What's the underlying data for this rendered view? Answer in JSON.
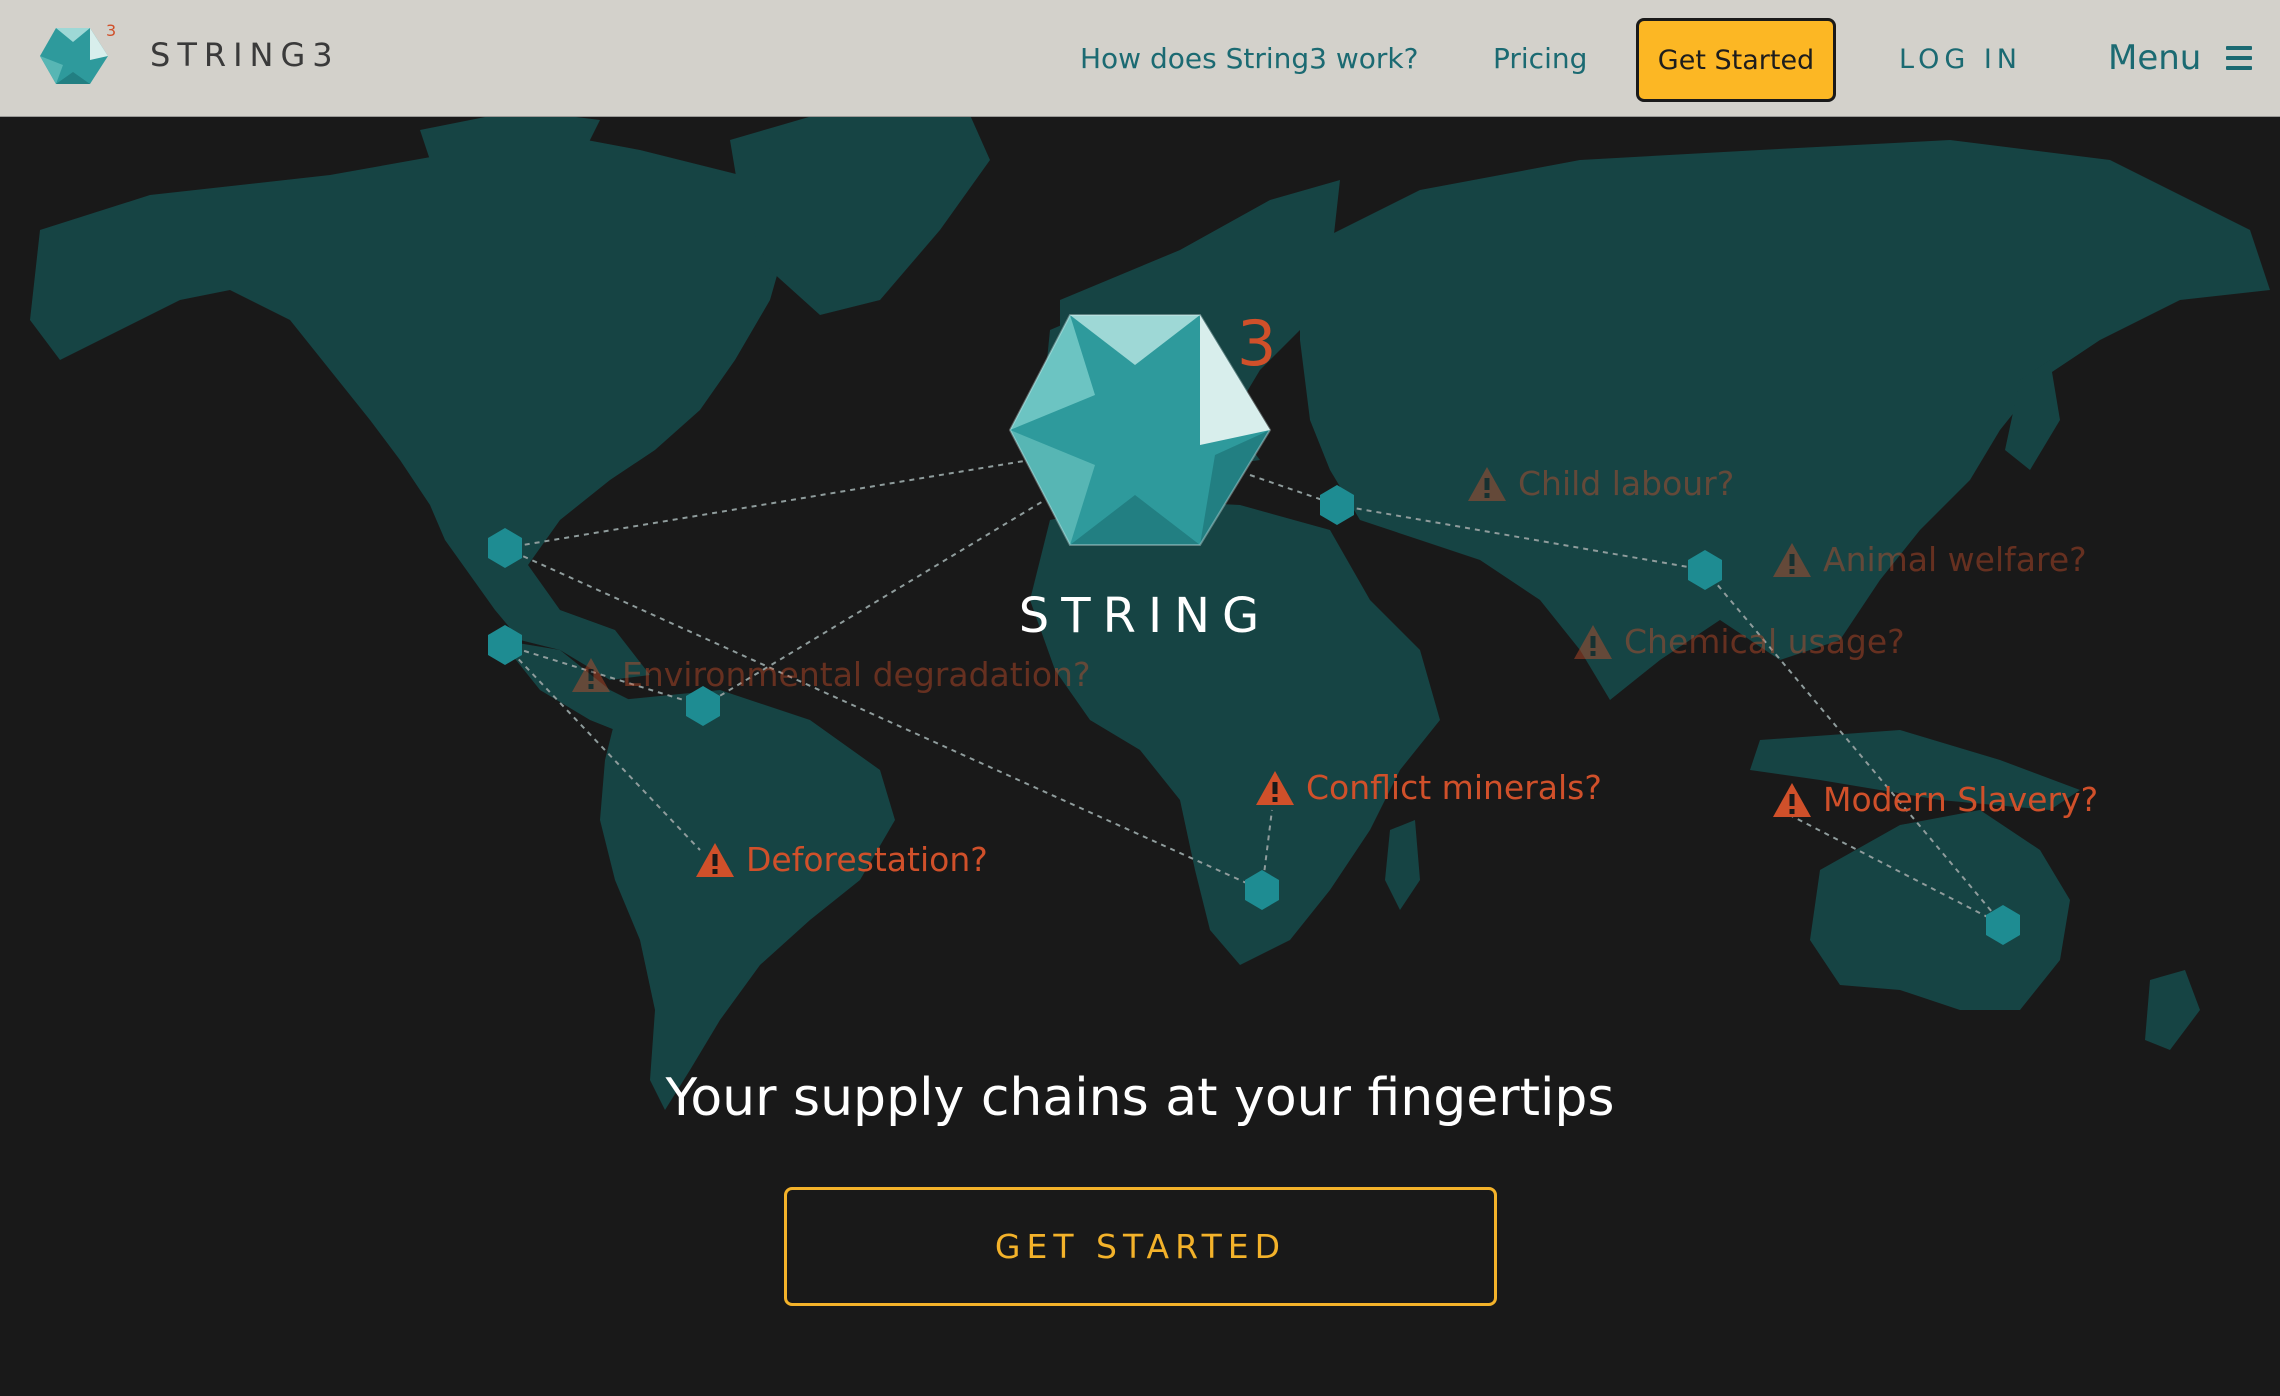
{
  "header": {
    "brand": "STRING3",
    "nav_links": [
      "How does String3 work?",
      "Pricing"
    ],
    "get_started_label": "Get Started",
    "login_label": "LOG IN",
    "menu_label": "Menu"
  },
  "hero": {
    "logo_superscript": "3",
    "logo_title": "STRING",
    "issues": [
      "Child labour?",
      "Animal welfare?",
      "Chemical usage?",
      "Environmental degradation?",
      "Conflict minerals?",
      "Modern Slavery?",
      "Deforestation?"
    ],
    "tagline": "Your supply chains at your fingertips",
    "cta_label": "GET STARTED"
  },
  "colors": {
    "background": "#191919",
    "land": "#164444",
    "header_bg": "#d3d1cb",
    "teal_accent": "#1b6a72",
    "cta_yellow": "#fcb724",
    "warning_red": "#d0502a"
  }
}
